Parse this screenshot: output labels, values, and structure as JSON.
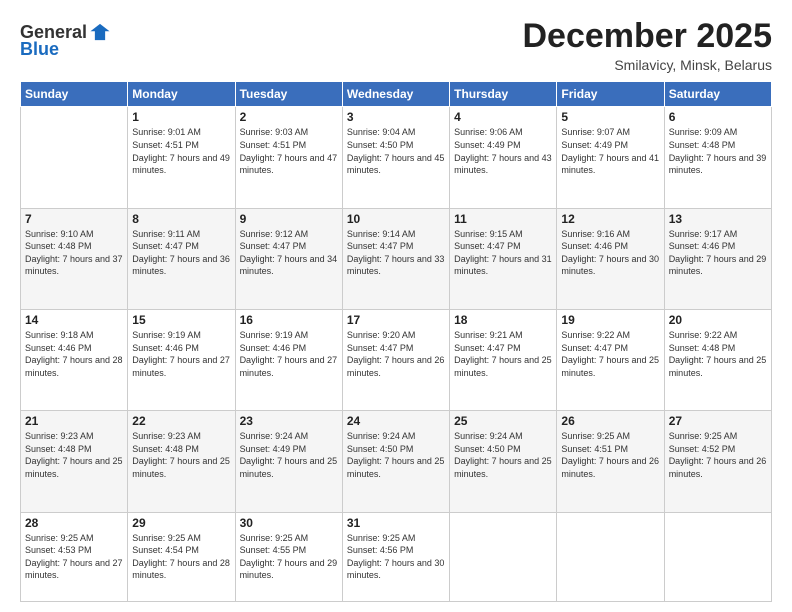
{
  "logo": {
    "general": "General",
    "blue": "Blue"
  },
  "header": {
    "month": "December 2025",
    "location": "Smilavicy, Minsk, Belarus"
  },
  "weekdays": [
    "Sunday",
    "Monday",
    "Tuesday",
    "Wednesday",
    "Thursday",
    "Friday",
    "Saturday"
  ],
  "weeks": [
    [
      {
        "day": "",
        "sunrise": "",
        "sunset": "",
        "daylight": ""
      },
      {
        "day": "1",
        "sunrise": "Sunrise: 9:01 AM",
        "sunset": "Sunset: 4:51 PM",
        "daylight": "Daylight: 7 hours and 49 minutes."
      },
      {
        "day": "2",
        "sunrise": "Sunrise: 9:03 AM",
        "sunset": "Sunset: 4:51 PM",
        "daylight": "Daylight: 7 hours and 47 minutes."
      },
      {
        "day": "3",
        "sunrise": "Sunrise: 9:04 AM",
        "sunset": "Sunset: 4:50 PM",
        "daylight": "Daylight: 7 hours and 45 minutes."
      },
      {
        "day": "4",
        "sunrise": "Sunrise: 9:06 AM",
        "sunset": "Sunset: 4:49 PM",
        "daylight": "Daylight: 7 hours and 43 minutes."
      },
      {
        "day": "5",
        "sunrise": "Sunrise: 9:07 AM",
        "sunset": "Sunset: 4:49 PM",
        "daylight": "Daylight: 7 hours and 41 minutes."
      },
      {
        "day": "6",
        "sunrise": "Sunrise: 9:09 AM",
        "sunset": "Sunset: 4:48 PM",
        "daylight": "Daylight: 7 hours and 39 minutes."
      }
    ],
    [
      {
        "day": "7",
        "sunrise": "Sunrise: 9:10 AM",
        "sunset": "Sunset: 4:48 PM",
        "daylight": "Daylight: 7 hours and 37 minutes."
      },
      {
        "day": "8",
        "sunrise": "Sunrise: 9:11 AM",
        "sunset": "Sunset: 4:47 PM",
        "daylight": "Daylight: 7 hours and 36 minutes."
      },
      {
        "day": "9",
        "sunrise": "Sunrise: 9:12 AM",
        "sunset": "Sunset: 4:47 PM",
        "daylight": "Daylight: 7 hours and 34 minutes."
      },
      {
        "day": "10",
        "sunrise": "Sunrise: 9:14 AM",
        "sunset": "Sunset: 4:47 PM",
        "daylight": "Daylight: 7 hours and 33 minutes."
      },
      {
        "day": "11",
        "sunrise": "Sunrise: 9:15 AM",
        "sunset": "Sunset: 4:47 PM",
        "daylight": "Daylight: 7 hours and 31 minutes."
      },
      {
        "day": "12",
        "sunrise": "Sunrise: 9:16 AM",
        "sunset": "Sunset: 4:46 PM",
        "daylight": "Daylight: 7 hours and 30 minutes."
      },
      {
        "day": "13",
        "sunrise": "Sunrise: 9:17 AM",
        "sunset": "Sunset: 4:46 PM",
        "daylight": "Daylight: 7 hours and 29 minutes."
      }
    ],
    [
      {
        "day": "14",
        "sunrise": "Sunrise: 9:18 AM",
        "sunset": "Sunset: 4:46 PM",
        "daylight": "Daylight: 7 hours and 28 minutes."
      },
      {
        "day": "15",
        "sunrise": "Sunrise: 9:19 AM",
        "sunset": "Sunset: 4:46 PM",
        "daylight": "Daylight: 7 hours and 27 minutes."
      },
      {
        "day": "16",
        "sunrise": "Sunrise: 9:19 AM",
        "sunset": "Sunset: 4:46 PM",
        "daylight": "Daylight: 7 hours and 27 minutes."
      },
      {
        "day": "17",
        "sunrise": "Sunrise: 9:20 AM",
        "sunset": "Sunset: 4:47 PM",
        "daylight": "Daylight: 7 hours and 26 minutes."
      },
      {
        "day": "18",
        "sunrise": "Sunrise: 9:21 AM",
        "sunset": "Sunset: 4:47 PM",
        "daylight": "Daylight: 7 hours and 25 minutes."
      },
      {
        "day": "19",
        "sunrise": "Sunrise: 9:22 AM",
        "sunset": "Sunset: 4:47 PM",
        "daylight": "Daylight: 7 hours and 25 minutes."
      },
      {
        "day": "20",
        "sunrise": "Sunrise: 9:22 AM",
        "sunset": "Sunset: 4:48 PM",
        "daylight": "Daylight: 7 hours and 25 minutes."
      }
    ],
    [
      {
        "day": "21",
        "sunrise": "Sunrise: 9:23 AM",
        "sunset": "Sunset: 4:48 PM",
        "daylight": "Daylight: 7 hours and 25 minutes."
      },
      {
        "day": "22",
        "sunrise": "Sunrise: 9:23 AM",
        "sunset": "Sunset: 4:48 PM",
        "daylight": "Daylight: 7 hours and 25 minutes."
      },
      {
        "day": "23",
        "sunrise": "Sunrise: 9:24 AM",
        "sunset": "Sunset: 4:49 PM",
        "daylight": "Daylight: 7 hours and 25 minutes."
      },
      {
        "day": "24",
        "sunrise": "Sunrise: 9:24 AM",
        "sunset": "Sunset: 4:50 PM",
        "daylight": "Daylight: 7 hours and 25 minutes."
      },
      {
        "day": "25",
        "sunrise": "Sunrise: 9:24 AM",
        "sunset": "Sunset: 4:50 PM",
        "daylight": "Daylight: 7 hours and 25 minutes."
      },
      {
        "day": "26",
        "sunrise": "Sunrise: 9:25 AM",
        "sunset": "Sunset: 4:51 PM",
        "daylight": "Daylight: 7 hours and 26 minutes."
      },
      {
        "day": "27",
        "sunrise": "Sunrise: 9:25 AM",
        "sunset": "Sunset: 4:52 PM",
        "daylight": "Daylight: 7 hours and 26 minutes."
      }
    ],
    [
      {
        "day": "28",
        "sunrise": "Sunrise: 9:25 AM",
        "sunset": "Sunset: 4:53 PM",
        "daylight": "Daylight: 7 hours and 27 minutes."
      },
      {
        "day": "29",
        "sunrise": "Sunrise: 9:25 AM",
        "sunset": "Sunset: 4:54 PM",
        "daylight": "Daylight: 7 hours and 28 minutes."
      },
      {
        "day": "30",
        "sunrise": "Sunrise: 9:25 AM",
        "sunset": "Sunset: 4:55 PM",
        "daylight": "Daylight: 7 hours and 29 minutes."
      },
      {
        "day": "31",
        "sunrise": "Sunrise: 9:25 AM",
        "sunset": "Sunset: 4:56 PM",
        "daylight": "Daylight: 7 hours and 30 minutes."
      },
      {
        "day": "",
        "sunrise": "",
        "sunset": "",
        "daylight": ""
      },
      {
        "day": "",
        "sunrise": "",
        "sunset": "",
        "daylight": ""
      },
      {
        "day": "",
        "sunrise": "",
        "sunset": "",
        "daylight": ""
      }
    ]
  ]
}
